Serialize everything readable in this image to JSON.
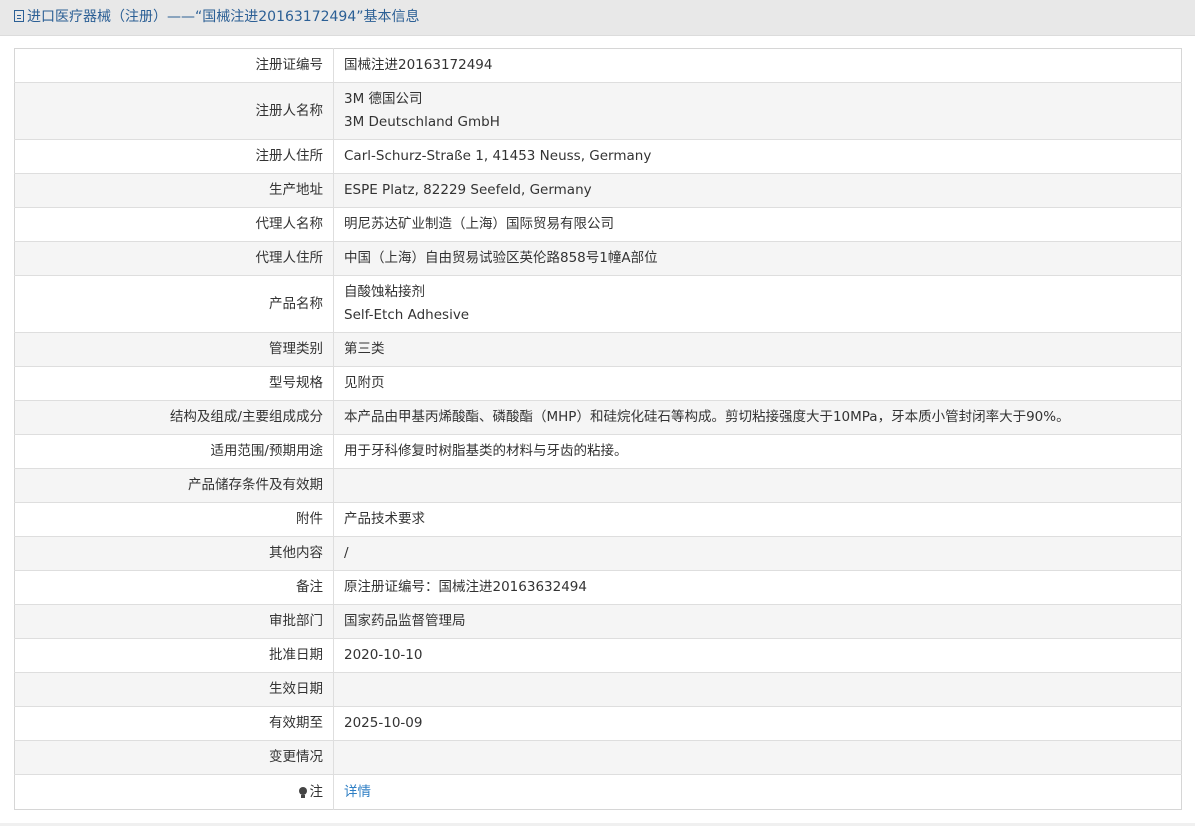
{
  "header": {
    "title": "进口医疗器械（注册）——“国械注进20163172494”基本信息"
  },
  "rows": [
    {
      "label": "注册证编号",
      "lines": [
        "国械注进20163172494"
      ]
    },
    {
      "label": "注册人名称",
      "lines": [
        "3M 德国公司",
        "3M Deutschland GmbH"
      ]
    },
    {
      "label": "注册人住所",
      "lines": [
        "Carl-Schurz-Straße 1, 41453 Neuss, Germany"
      ]
    },
    {
      "label": "生产地址",
      "lines": [
        "ESPE Platz, 82229 Seefeld, Germany"
      ]
    },
    {
      "label": "代理人名称",
      "lines": [
        "明尼苏达矿业制造（上海）国际贸易有限公司"
      ]
    },
    {
      "label": "代理人住所",
      "lines": [
        "中国（上海）自由贸易试验区英伦路858号1幢A部位"
      ]
    },
    {
      "label": "产品名称",
      "lines": [
        "自酸蚀粘接剂",
        "Self-Etch Adhesive"
      ]
    },
    {
      "label": "管理类别",
      "lines": [
        "第三类"
      ]
    },
    {
      "label": "型号规格",
      "lines": [
        "见附页"
      ]
    },
    {
      "label": "结构及组成/主要组成成分",
      "lines": [
        "本产品由甲基丙烯酸酯、磷酸酯（MHP）和硅烷化硅石等构成。剪切粘接强度大于10MPa，牙本质小管封闭率大于90%。"
      ]
    },
    {
      "label": "适用范围/预期用途",
      "lines": [
        "用于牙科修复时树脂基类的材料与牙齿的粘接。"
      ]
    },
    {
      "label": "产品储存条件及有效期",
      "lines": []
    },
    {
      "label": "附件",
      "lines": [
        "产品技术要求"
      ]
    },
    {
      "label": "其他内容",
      "lines": [
        "/"
      ]
    },
    {
      "label": "备注",
      "lines": [
        "原注册证编号：国械注进20163632494"
      ]
    },
    {
      "label": "审批部门",
      "lines": [
        "国家药品监督管理局"
      ]
    },
    {
      "label": "批准日期",
      "lines": [
        "2020-10-10"
      ]
    },
    {
      "label": "生效日期",
      "lines": []
    },
    {
      "label": "有效期至",
      "lines": [
        "2025-10-09"
      ]
    },
    {
      "label": "变更情况",
      "lines": []
    }
  ],
  "note_row": {
    "icon": "lightbulb-icon",
    "label": "注",
    "link_text": "详情"
  }
}
